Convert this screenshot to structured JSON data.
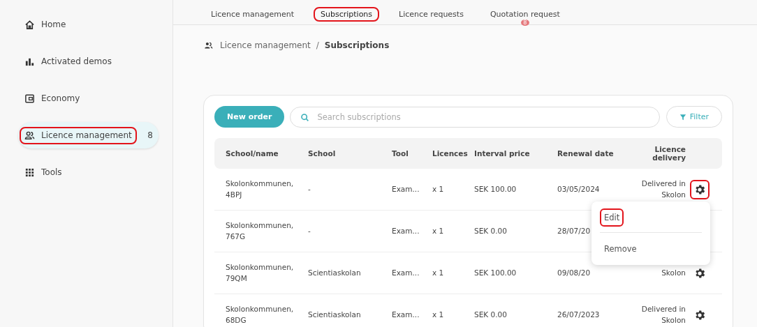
{
  "sidebar": {
    "items": [
      {
        "label": "Home",
        "selected": false,
        "annotated": false
      },
      {
        "label": "Activated demos",
        "selected": false,
        "annotated": false
      },
      {
        "label": "Economy",
        "selected": false,
        "annotated": false
      },
      {
        "label": "Licence management",
        "count": "8",
        "selected": true,
        "annotated": true
      },
      {
        "label": "Tools",
        "selected": false,
        "annotated": false
      }
    ]
  },
  "tabs": [
    {
      "label": "Licence management",
      "selected": false,
      "annotated": false
    },
    {
      "label": "Subscriptions",
      "selected": true,
      "annotated": true
    },
    {
      "label": "Licence requests",
      "selected": false,
      "annotated": false
    },
    {
      "label": "Quotation request",
      "selected": false,
      "annotated": false,
      "badge": "8"
    }
  ],
  "breadcrumb": {
    "parent": "Licence management",
    "separator": "/",
    "current": "Subscriptions"
  },
  "toolbar": {
    "new_button": "New order",
    "search": {
      "placeholder": "Search subscriptions"
    },
    "filter_button": "Filter"
  },
  "table": {
    "columns": [
      "School/name",
      "School",
      "Tool",
      "Licences",
      "Interval price",
      "Renewal date",
      "Licence delivery"
    ],
    "rows": [
      {
        "cells": [
          "Skolonkommunen, 4BPJ",
          "-",
          "Exam...",
          "x 1",
          "SEK 100.00",
          "03/05/2024",
          "Delivered in Skolon"
        ],
        "has_gear": true,
        "gear_annotated": true
      },
      {
        "cells": [
          "Skolonkommunen, 767G",
          "-",
          "Exam...",
          "x 1",
          "SEK 0.00",
          "28/07/20"
        ],
        "has_gear": false
      },
      {
        "cells": [
          "Skolonkommunen, 79QM",
          "Scientiaskolan",
          "Exam...",
          "x 1",
          "SEK 100.00",
          "09/08/20",
          "Skolon"
        ],
        "has_gear": true
      },
      {
        "cells": [
          "Skolonkommunen, 68DG",
          "Scientiaskolan",
          "Exam...",
          "x 1",
          "SEK 0.00",
          "26/07/2023",
          "Delivered in Skolon"
        ],
        "has_gear": true
      }
    ]
  },
  "menu": {
    "items": [
      {
        "label": "Edit",
        "annotated": true
      },
      {
        "label": "Remove",
        "annotated": false
      }
    ]
  }
}
